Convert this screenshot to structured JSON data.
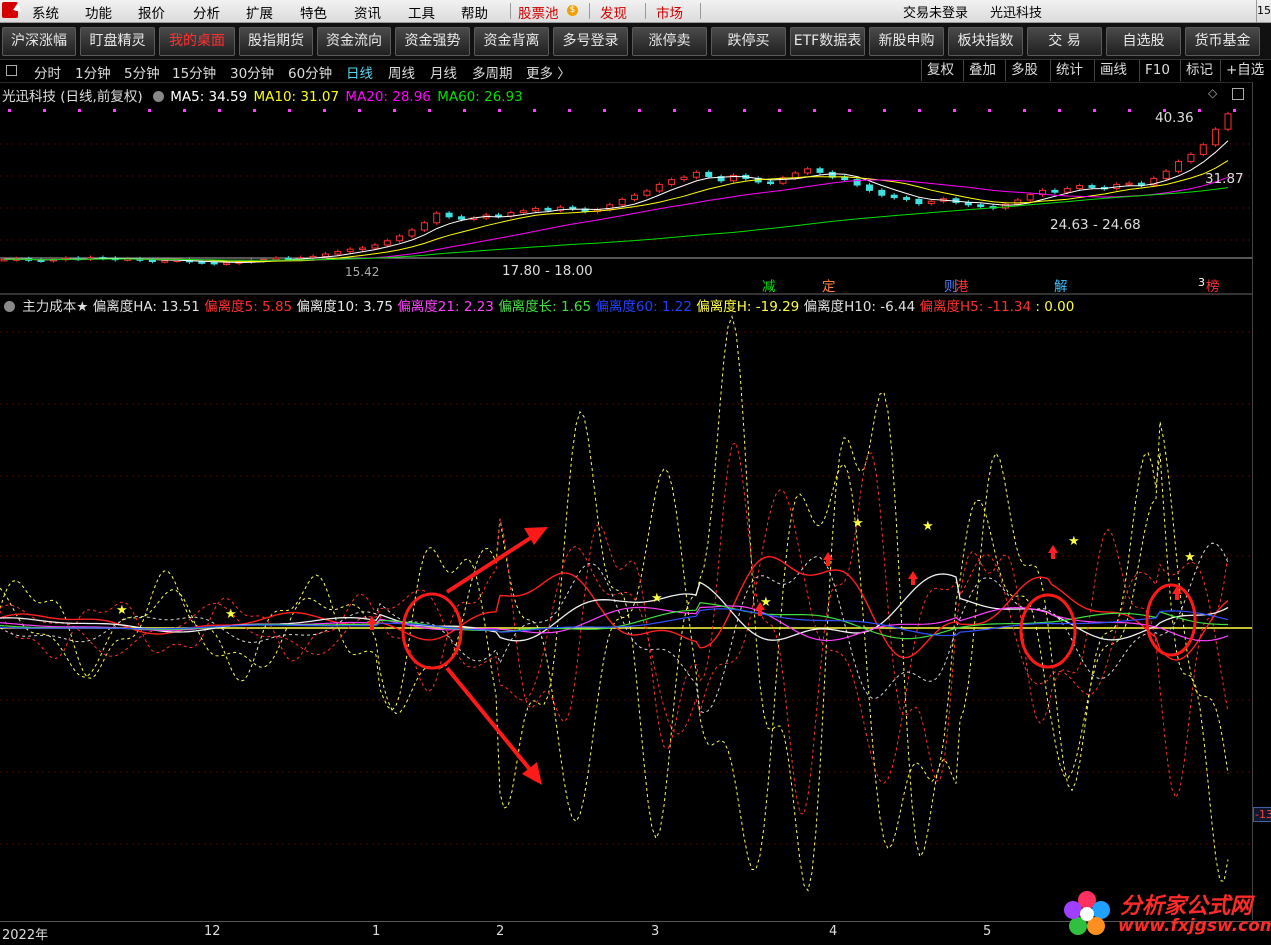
{
  "menu": {
    "items": [
      "系统",
      "功能",
      "报价",
      "分析",
      "扩展",
      "特色",
      "资讯",
      "工具",
      "帮助"
    ],
    "highlighted": [
      "股票池",
      "发现",
      "市场"
    ],
    "login_status": "交易未登录",
    "stock_name": "光迅科技",
    "corner": "15"
  },
  "toolbar": {
    "buttons": [
      "沪深涨幅",
      "盯盘精灵",
      "我的桌面",
      "股指期货",
      "资金流向",
      "资金强势",
      "资金背离",
      "多号登录",
      "涨停卖",
      "跌停买",
      "ETF数据表",
      "新股申购",
      "板块指数",
      "交 易",
      "自选股",
      "货币基金"
    ],
    "active": "我的桌面"
  },
  "periods": {
    "items": [
      "分时",
      "1分钟",
      "5分钟",
      "15分钟",
      "30分钟",
      "60分钟",
      "日线",
      "周线",
      "月线",
      "多周期",
      "更多 〉"
    ],
    "active": "日线",
    "right_buttons": [
      "复权",
      "叠加",
      "多股",
      "统计",
      "画线",
      "F10",
      "标记",
      "+自选"
    ]
  },
  "price_panel": {
    "title": "光迅科技 (日线,前复权)",
    "ma": [
      {
        "label": "MA5: 34.59",
        "color": "#ffffff"
      },
      {
        "label": "MA10: 31.07",
        "color": "#ffff00"
      },
      {
        "label": "MA20: 28.96",
        "color": "#ff00ff"
      },
      {
        "label": "MA60: 26.93",
        "color": "#00e000"
      }
    ],
    "annotations": {
      "high": "40.36",
      "mid": "31.87",
      "range1": "24.63 - 24.68",
      "range2": "17.80 - 18.00",
      "low": "15.42"
    },
    "events": [
      {
        "text": "减",
        "color": "#00e000"
      },
      {
        "text": "定",
        "color": "#ff8040"
      },
      {
        "text": "则",
        "color": "#5080ff"
      },
      {
        "text": "港",
        "color": "#ff3030"
      },
      {
        "text": "解",
        "color": "#40c0ff"
      },
      {
        "text": "榜",
        "color": "#ff3030"
      },
      {
        "text": "3",
        "color": "#ffffff"
      }
    ],
    "closes": [
      16.1,
      16.2,
      16.0,
      15.9,
      16.1,
      16.3,
      16.2,
      16.4,
      16.3,
      16.1,
      16.2,
      16.0,
      15.8,
      15.9,
      16.0,
      15.7,
      15.6,
      15.42,
      15.5,
      15.7,
      15.9,
      16.1,
      16.3,
      16.2,
      16.4,
      16.6,
      17.0,
      17.4,
      17.8,
      18.0,
      18.5,
      19.2,
      20.0,
      21.0,
      22.2,
      23.8,
      23.2,
      22.8,
      23.0,
      23.5,
      23.3,
      23.9,
      24.2,
      24.6,
      24.3,
      24.8,
      24.5,
      24.1,
      24.4,
      25.2,
      26.1,
      26.8,
      27.5,
      28.6,
      29.4,
      29.8,
      30.6,
      29.9,
      29.2,
      30.1,
      29.6,
      29.0,
      28.8,
      29.7,
      30.5,
      31.2,
      30.6,
      29.8,
      29.4,
      28.5,
      27.6,
      26.8,
      26.4,
      26.1,
      25.4,
      25.8,
      26.2,
      25.6,
      25.2,
      24.9,
      24.65,
      25.3,
      26.0,
      26.9,
      27.6,
      27.3,
      27.9,
      28.4,
      28.1,
      27.9,
      28.6,
      28.8,
      28.5,
      29.6,
      30.8,
      32.4,
      33.6,
      35.2,
      37.8,
      40.36
    ]
  },
  "indicator_panel": {
    "name": "主力成本★",
    "values": [
      {
        "label": "偏离度HA: 13.51",
        "color": "#e0e0e0"
      },
      {
        "label": "偏离度5: 5.85",
        "color": "#ff3030"
      },
      {
        "label": "偏离度10: 3.75",
        "color": "#e8e8e8"
      },
      {
        "label": "偏离度21: 2.23",
        "color": "#ff40ff"
      },
      {
        "label": "偏离度长: 1.65",
        "color": "#40e040"
      },
      {
        "label": "偏离度60: 1.22",
        "color": "#2040ff"
      },
      {
        "label": "偏离度H: -19.29",
        "color": "#ffff40"
      },
      {
        "label": "偏离度H10: -6.44",
        "color": "#e0e0e0"
      },
      {
        "label": "偏离度H5: -11.34",
        "color": "#ff3030"
      },
      {
        "label": ": 0.00",
        "color": "#ffff40"
      }
    ],
    "right_value": "-13",
    "series_colors": {
      "red": "#ff2020",
      "white": "#f0f0f0",
      "magenta": "#ff40ff",
      "green": "#40e040",
      "blue": "#3050ff",
      "yellow_dashed": "#ffff50",
      "red_dashed": "#ff3030",
      "white_dashed": "#d8d8d8",
      "zero_line": "#ffff40"
    }
  },
  "dates": [
    "2022年",
    "12",
    "1",
    "2",
    "3",
    "4",
    "5"
  ],
  "watermark": {
    "cn": "分析家公式网",
    "url": "www.fxjgsw.com"
  }
}
